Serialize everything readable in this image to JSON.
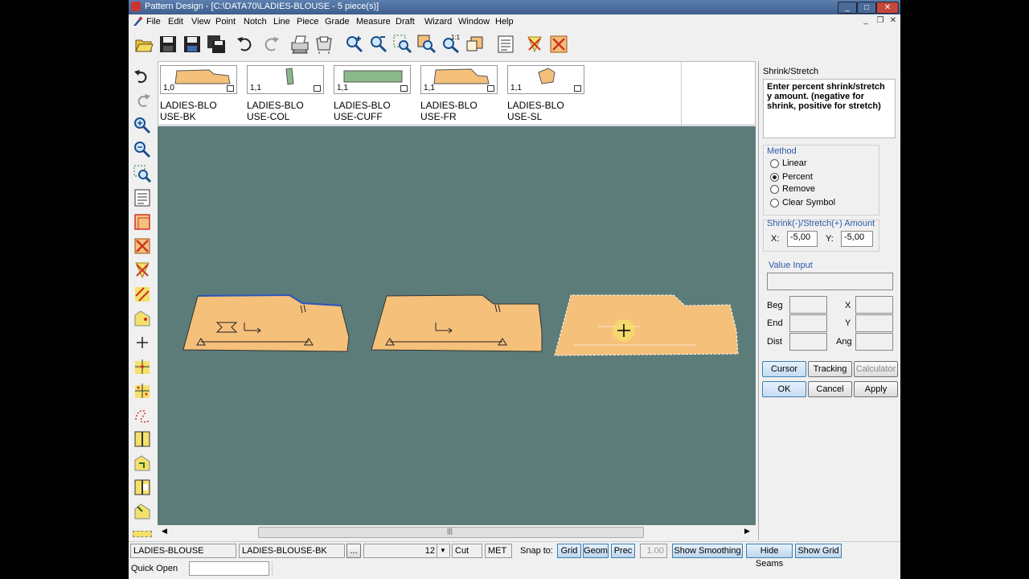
{
  "window": {
    "title": "Pattern Design - [C:\\DATA70\\LADIES-BLOUSE  - 5 piece(s)]",
    "min": "_",
    "max": "□",
    "close": "✕"
  },
  "menu": [
    "File",
    "Edit",
    "View",
    "Point",
    "Notch",
    "Line",
    "Piece",
    "Grade",
    "Measure",
    "Draft",
    "Wizard",
    "Window",
    "Help"
  ],
  "pieces": [
    {
      "count": "1,0",
      "label": "LADIES-BLO\nUSE-BK"
    },
    {
      "count": "1,1",
      "label": "LADIES-BLO\nUSE-COL"
    },
    {
      "count": "1,1",
      "label": "LADIES-BLO\nUSE-CUFF"
    },
    {
      "count": "1,1",
      "label": "LADIES-BLO\nUSE-FR"
    },
    {
      "count": "1,1",
      "label": "LADIES-BLO\nUSE-SL"
    }
  ],
  "panel": {
    "title": "Shrink/Stretch",
    "prompt": "Enter percent shrink/stretch y amount. (negative for shrink, positive for stretch)",
    "method_label": "Method",
    "methods": [
      {
        "label": "Linear",
        "selected": false
      },
      {
        "label": "Percent",
        "selected": true
      },
      {
        "label": "Remove",
        "selected": false
      },
      {
        "label": "Clear Symbol",
        "selected": false
      }
    ],
    "amount_label": "Shrink(-)/Stretch(+) Amount",
    "x_label": "X:",
    "x_value": "-5,00",
    "y_label": "Y:",
    "y_value": "-5,00",
    "value_input_label": "Value Input",
    "value_input": "",
    "beg_label": "Beg",
    "end_label": "End",
    "dist_label": "Dist",
    "x2_label": "X",
    "y2_label": "Y",
    "ang_label": "Ang",
    "cursor_btn": "Cursor",
    "tracking_btn": "Tracking",
    "calculator_btn": "Calculator",
    "ok_btn": "OK",
    "cancel_btn": "Cancel",
    "apply_btn": "Apply"
  },
  "status": {
    "style": "LADIES-BLOUSE",
    "piece": "LADIES-BLOUSE-BK",
    "ellipsis": "...",
    "size_value": "12",
    "cut": "Cut",
    "unit": "MET",
    "snap_label": "Snap to:",
    "grid": "Grid",
    "geom": "Geom",
    "prec": "Prec",
    "prec_value": "1.00",
    "show_smoothing": "Show Smoothing",
    "hide_seams": "Hide Seams",
    "show_grid": "Show Grid",
    "quick_open": "Quick Open"
  },
  "colors": {
    "canvas": "#5c7c7a",
    "piece_fill": "#f5c07a",
    "accent": "#3c7fb1"
  }
}
